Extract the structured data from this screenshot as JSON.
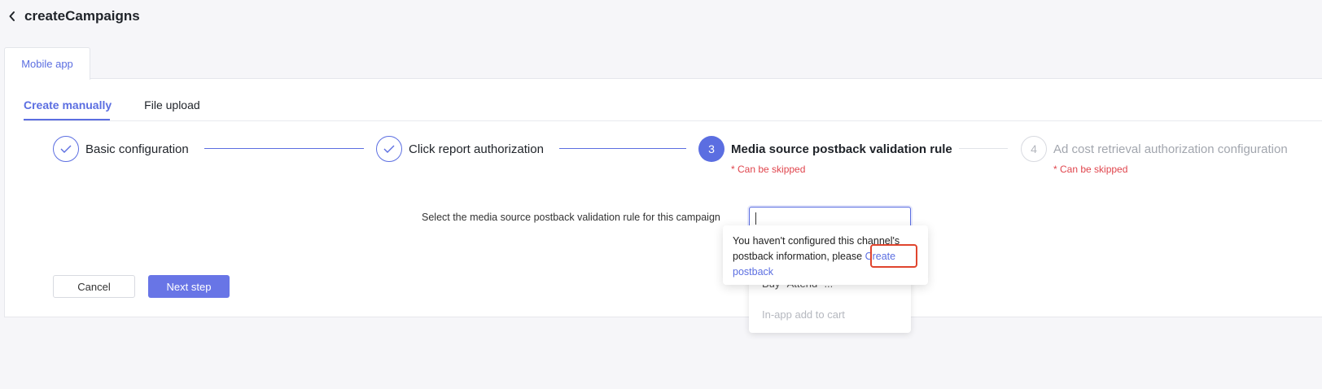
{
  "header": {
    "title": "createCampaigns"
  },
  "tabs": {
    "mobile": "Mobile app"
  },
  "sub_tabs": [
    {
      "label": "Create manually",
      "active": true
    },
    {
      "label": "File upload",
      "active": false
    }
  ],
  "steps": [
    {
      "number": "",
      "title": "Basic configuration",
      "state": "done",
      "note": ""
    },
    {
      "number": "",
      "title": "Click report authorization",
      "state": "done",
      "note": ""
    },
    {
      "number": "3",
      "title": "Media source postback validation rule",
      "state": "active",
      "note": "* Can be skipped"
    },
    {
      "number": "4",
      "title": "Ad cost retrieval authorization configuration",
      "state": "pending",
      "note": "* Can be skipped"
    }
  ],
  "form": {
    "label": "Select the media source postback validation rule for this campaign",
    "value": ""
  },
  "dropdown": {
    "options": [
      "Buy \"Attend\" ...",
      "In-app add to cart"
    ]
  },
  "popover": {
    "text": "You haven't configured this channel's postback information, please ",
    "link": "Create postback"
  },
  "buttons": {
    "cancel": "Cancel",
    "next": "Next step"
  },
  "colors": {
    "accent": "#5b6ee1",
    "warning": "#e0454d",
    "highlight": "#e0452e"
  }
}
